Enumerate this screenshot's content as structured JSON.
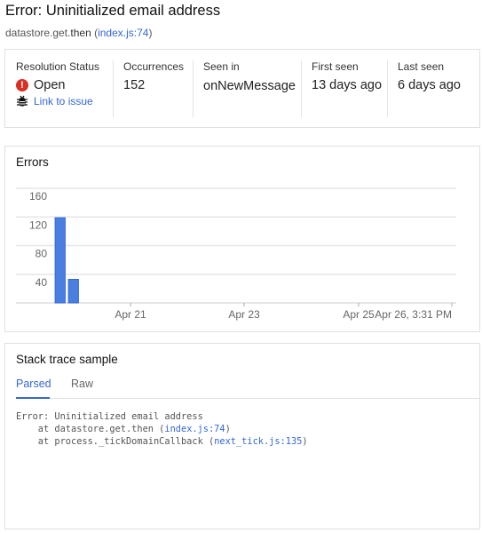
{
  "header": {
    "title": "Error: Uninitialized email address",
    "func": "datastore.get.",
    "func_bold": "then",
    "open_paren": " (",
    "location": "index.js:74",
    "close_paren": ")"
  },
  "summary": {
    "resolution": {
      "label": "Resolution Status",
      "status": "Open",
      "status_icon": "error-icon",
      "link": "Link to issue",
      "link_icon": "bug-icon",
      "status_color": "#d93025"
    },
    "occurrences": {
      "label": "Occurrences",
      "value": "152"
    },
    "seen_in": {
      "label": "Seen in",
      "value": "onNewMessage"
    },
    "first_seen": {
      "label": "First seen",
      "value": "13 days ago"
    },
    "last_seen": {
      "label": "Last seen",
      "value": "6 days ago"
    }
  },
  "errors_card": {
    "title": "Errors"
  },
  "chart_data": {
    "type": "bar",
    "ylim": [
      0,
      160
    ],
    "yticks": [
      "40",
      "80",
      "120",
      "160"
    ],
    "xticks": [
      "Apr 21",
      "Apr 23",
      "Apr 25",
      "Apr 26, 3:31 PM"
    ],
    "x": [
      "Apr 19, 6 PM",
      "Apr 20, 12 AM"
    ],
    "values": [
      119,
      33
    ],
    "color": "#4a7fe0",
    "grid": true
  },
  "stack": {
    "title": "Stack trace sample",
    "tabs": [
      "Parsed",
      "Raw"
    ],
    "active_tab": "Parsed",
    "line0": "Error: Uninitialized email address",
    "line1_pre": "    at datastore.get.then (",
    "line1_link": "index.js:74",
    "line1_post": ")",
    "line2_pre": "    at process._tickDomainCallback (",
    "line2_link": "next_tick.js:135",
    "line2_post": ")"
  }
}
